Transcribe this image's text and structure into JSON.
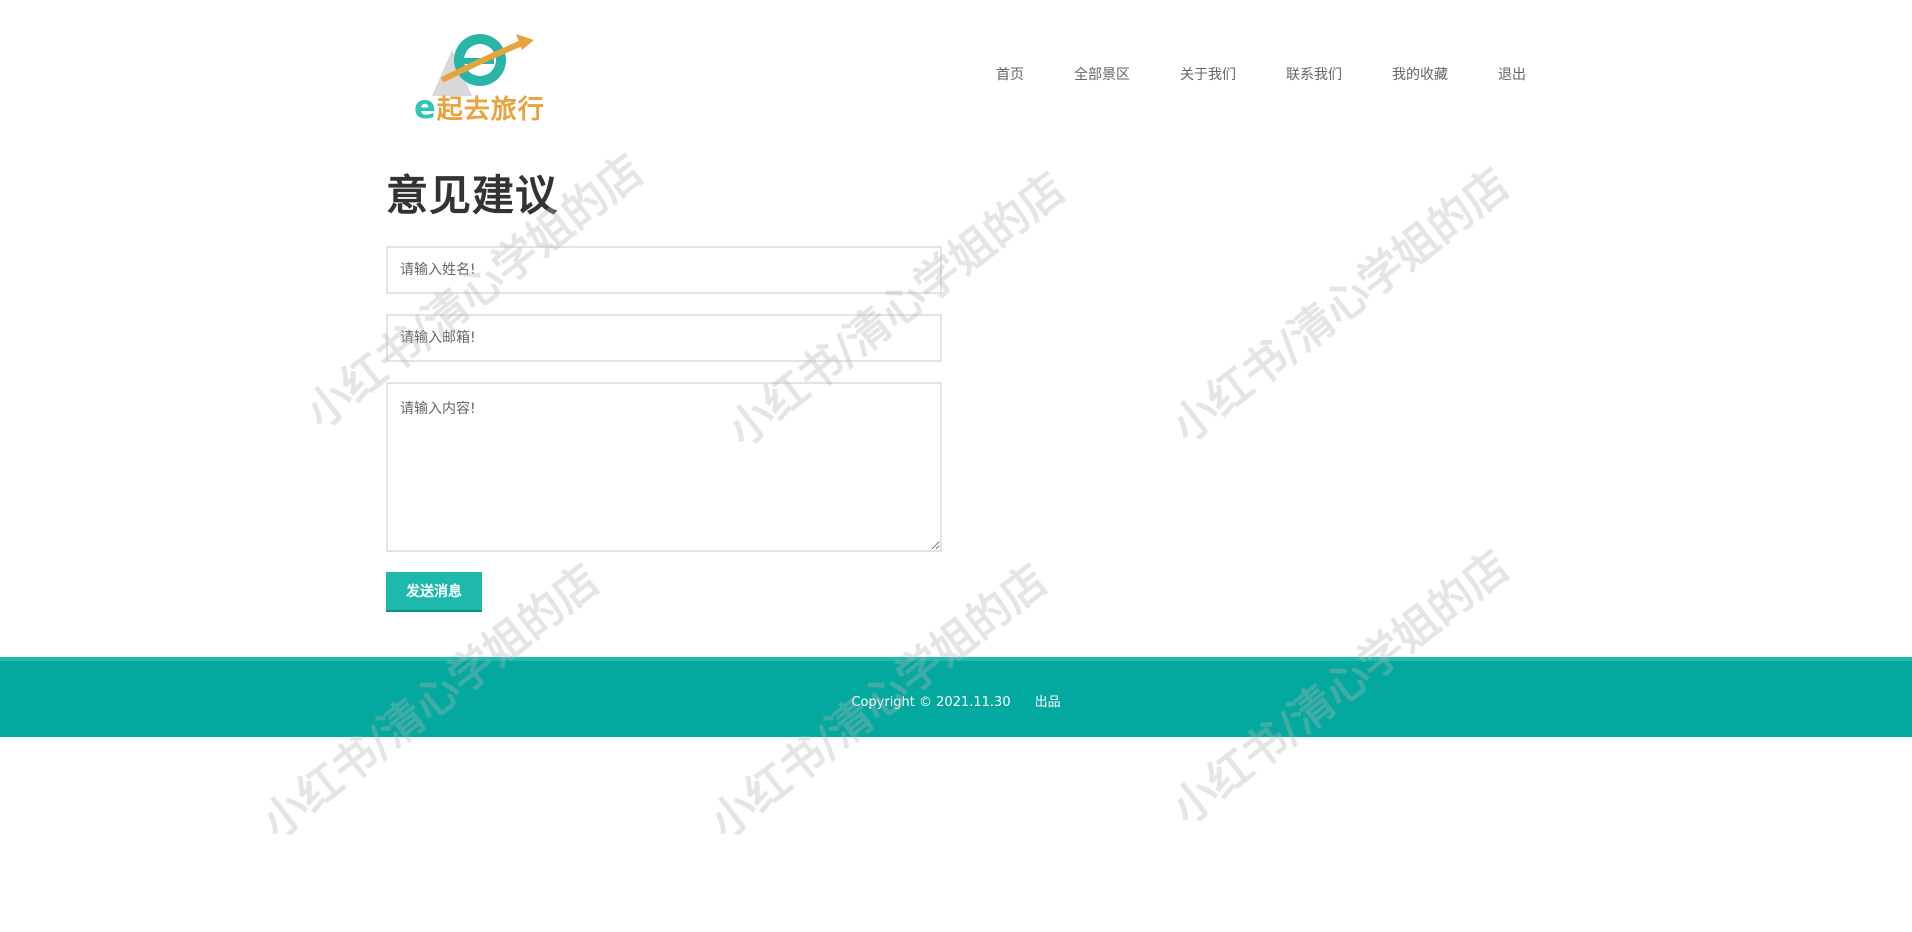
{
  "brand": {
    "logo_letter": "e",
    "logo_text": "起去旅行",
    "colors": {
      "teal": "#2ec4b6",
      "orange": "#e8a33d"
    }
  },
  "nav": {
    "items": [
      {
        "label": "首页"
      },
      {
        "label": "全部景区"
      },
      {
        "label": "关于我们"
      },
      {
        "label": "联系我们"
      },
      {
        "label": "我的收藏"
      },
      {
        "label": "退出"
      }
    ]
  },
  "form": {
    "title": "意见建议",
    "name_placeholder": "请输入姓名!",
    "email_placeholder": "请输入邮箱!",
    "content_placeholder": "请输入内容!",
    "submit_label": "发送消息"
  },
  "footer": {
    "copyright": "Copyright © 2021.11.30",
    "credit": "出品",
    "color": "#03a89e"
  },
  "watermark": {
    "text": "小红书/清心学姐的店"
  }
}
